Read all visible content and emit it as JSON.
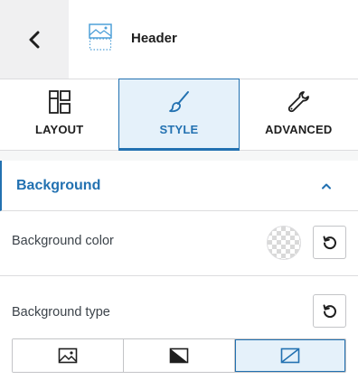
{
  "header": {
    "back_icon": "chevron-left-icon",
    "block_icon": "header-block-icon",
    "title": "Header"
  },
  "tabs": [
    {
      "label": "LAYOUT",
      "icon": "layout-icon",
      "active": false
    },
    {
      "label": "STYLE",
      "icon": "brush-icon",
      "active": true
    },
    {
      "label": "ADVANCED",
      "icon": "wrench-icon",
      "active": false
    }
  ],
  "section": {
    "title": "Background",
    "expanded": true,
    "toggle_icon": "chevron-up-icon"
  },
  "background_color": {
    "label": "Background color",
    "value": "transparent",
    "reset_icon": "reset-icon"
  },
  "background_type": {
    "label": "Background type",
    "reset_icon": "reset-icon",
    "options": [
      {
        "icon": "image-icon",
        "selected": false
      },
      {
        "icon": "gradient-icon",
        "selected": false
      },
      {
        "icon": "no-background-icon",
        "selected": true
      }
    ]
  },
  "colors": {
    "accent": "#2271b1",
    "active_bg": "#e5f1fa",
    "border": "#dcdcde"
  }
}
